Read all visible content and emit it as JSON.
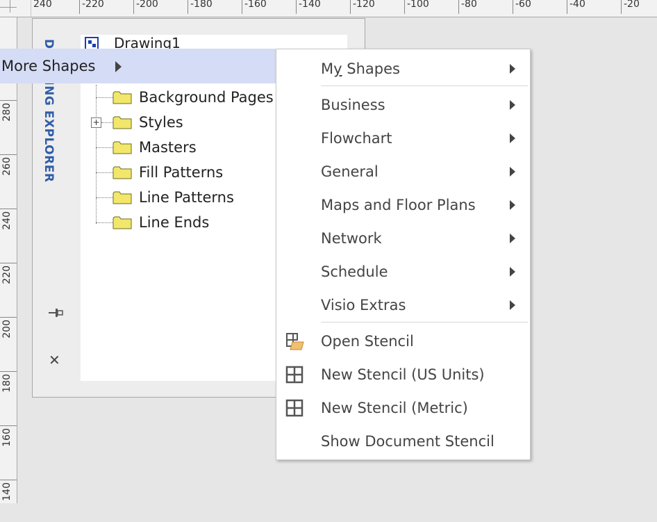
{
  "ruler_top": {
    "labels": [
      "240",
      "-220",
      "-200",
      "-180",
      "-160",
      "-140",
      "-120",
      "-100",
      "-80",
      "-60",
      "-40",
      "-20"
    ]
  },
  "ruler_left": {
    "labels": [
      "280",
      "260",
      "240",
      "220",
      "200",
      "180",
      "160",
      "140"
    ]
  },
  "explorer": {
    "title": "DRAWING EXPLORER",
    "document": "Drawing1",
    "items": [
      {
        "label": "Background Pages"
      },
      {
        "label": "Styles"
      },
      {
        "label": "Masters"
      },
      {
        "label": "Fill Patterns"
      },
      {
        "label": "Line Patterns"
      },
      {
        "label": "Line Ends"
      }
    ]
  },
  "context": {
    "more_shapes": "More Shapes"
  },
  "submenu": {
    "my_shapes_prefix": "M",
    "my_shapes_underlined": "y",
    "my_shapes_rest": " Shapes",
    "categories": [
      {
        "label": "Business"
      },
      {
        "label": "Flowchart"
      },
      {
        "label": "General"
      },
      {
        "label": "Maps and Floor Plans"
      },
      {
        "label": "Network"
      },
      {
        "label": "Schedule"
      },
      {
        "label": "Visio Extras"
      }
    ],
    "actions": [
      {
        "label": "Open Stencil",
        "icon": "open-stencil-icon"
      },
      {
        "label": "New Stencil (US Units)",
        "icon": "new-stencil-icon"
      },
      {
        "label": "New Stencil (Metric)",
        "icon": "new-stencil-icon"
      },
      {
        "label": "Show Document Stencil",
        "icon": ""
      }
    ]
  },
  "colors": {
    "highlight": "#d5dcf5",
    "explorer_title": "#2f5da8",
    "folder": "#f2e76a"
  }
}
